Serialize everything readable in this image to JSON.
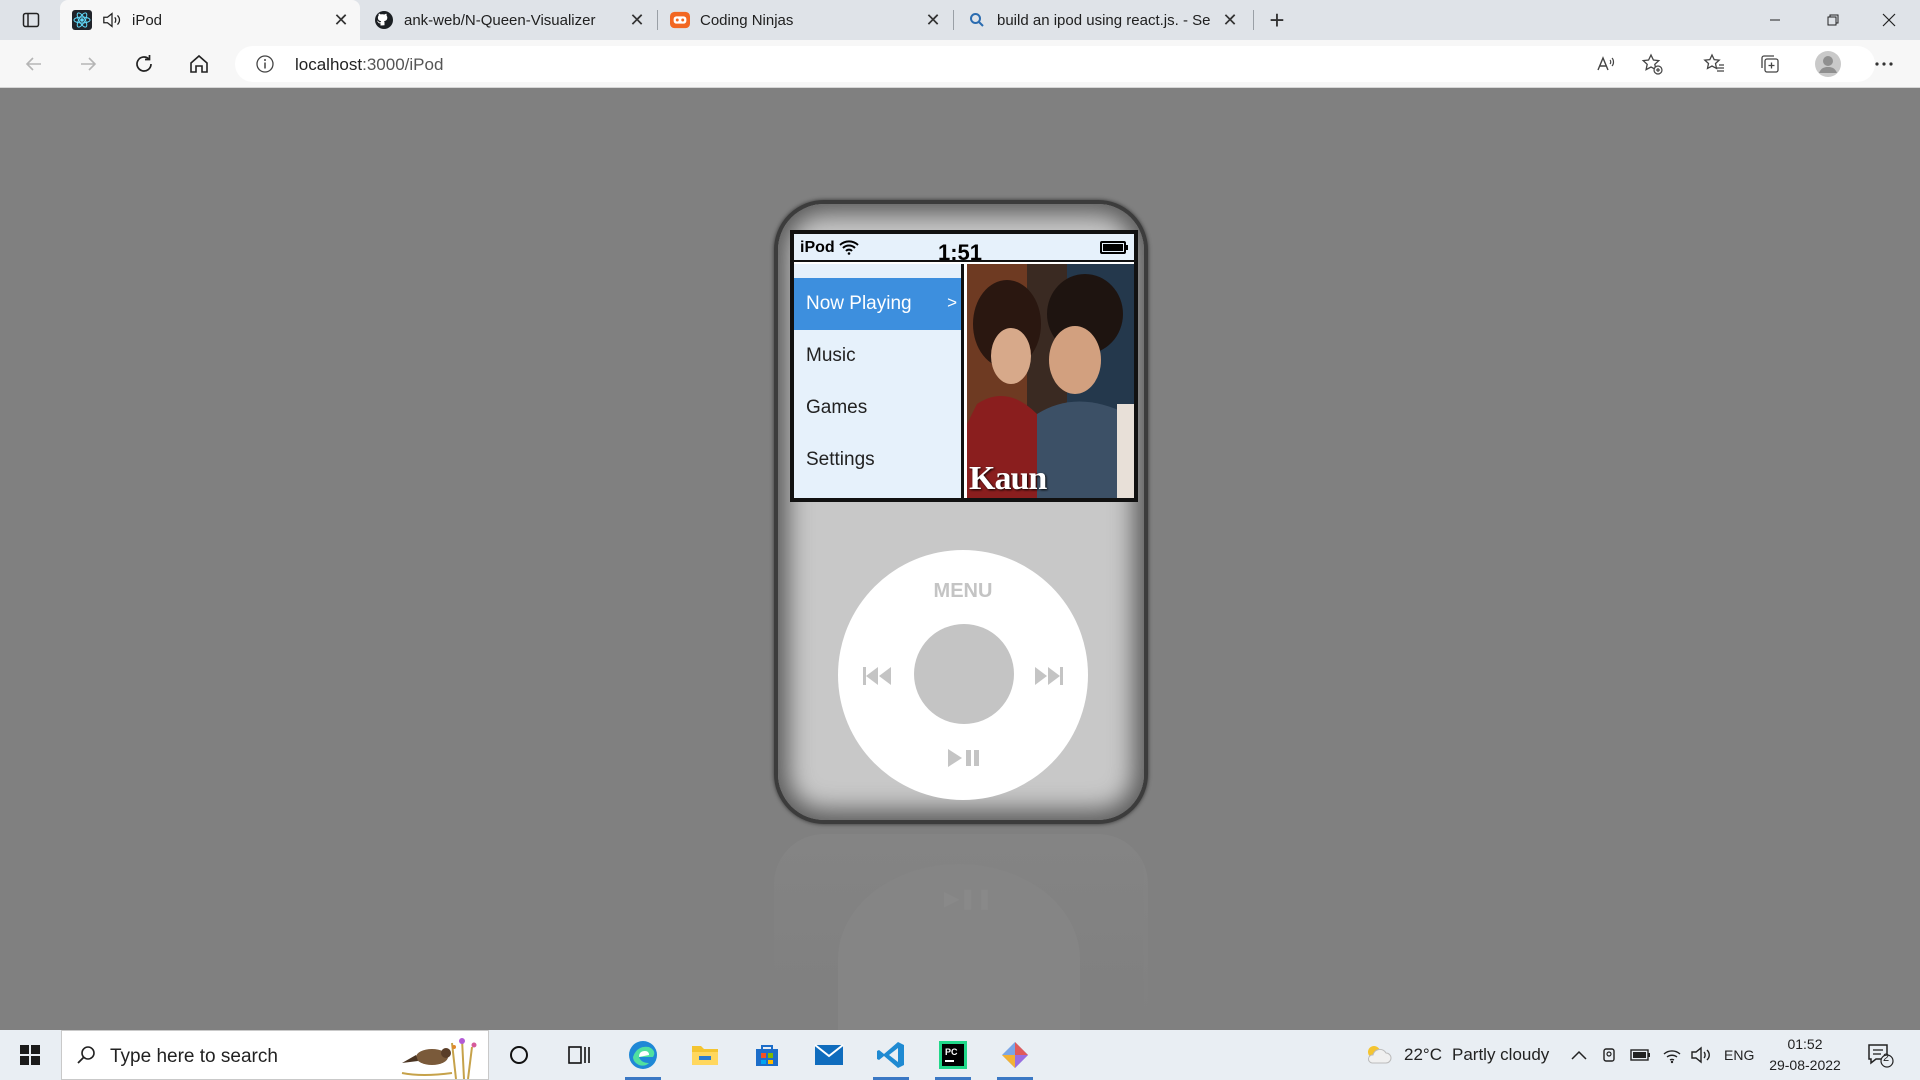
{
  "browser": {
    "tabs": [
      {
        "title": "iPod",
        "active": true,
        "icon": "react-icon"
      },
      {
        "title": "ank-web/N-Queen-Visualizer",
        "active": false,
        "icon": "github-icon"
      },
      {
        "title": "Coding Ninjas",
        "active": false,
        "icon": "coding-ninjas-icon"
      },
      {
        "title": "build an ipod using react.js. - Se",
        "active": false,
        "icon": "search-icon"
      }
    ],
    "url_host": "localhost",
    "url_path": ":3000/iPod"
  },
  "ipod": {
    "brand": "iPod",
    "time": "1:51",
    "menu": [
      {
        "label": "Now Playing",
        "selected": true
      },
      {
        "label": "Music",
        "selected": false
      },
      {
        "label": "Games",
        "selected": false
      },
      {
        "label": "Settings",
        "selected": false
      }
    ],
    "selected_arrow": ">",
    "cover_text": "Kaun",
    "wheel_menu_label": "MENU",
    "colors": {
      "selected": "#3d8fde",
      "screen_bg": "#e6f1fb",
      "body": "#c8c8c8",
      "wheel_controls": "#c4c4c4"
    }
  },
  "taskbar": {
    "search_placeholder": "Type here to search",
    "weather": "22°C",
    "weather_desc": "Partly cloudy",
    "language": "ENG",
    "time": "01:52",
    "date": "29-08-2022",
    "notifications": "2"
  }
}
